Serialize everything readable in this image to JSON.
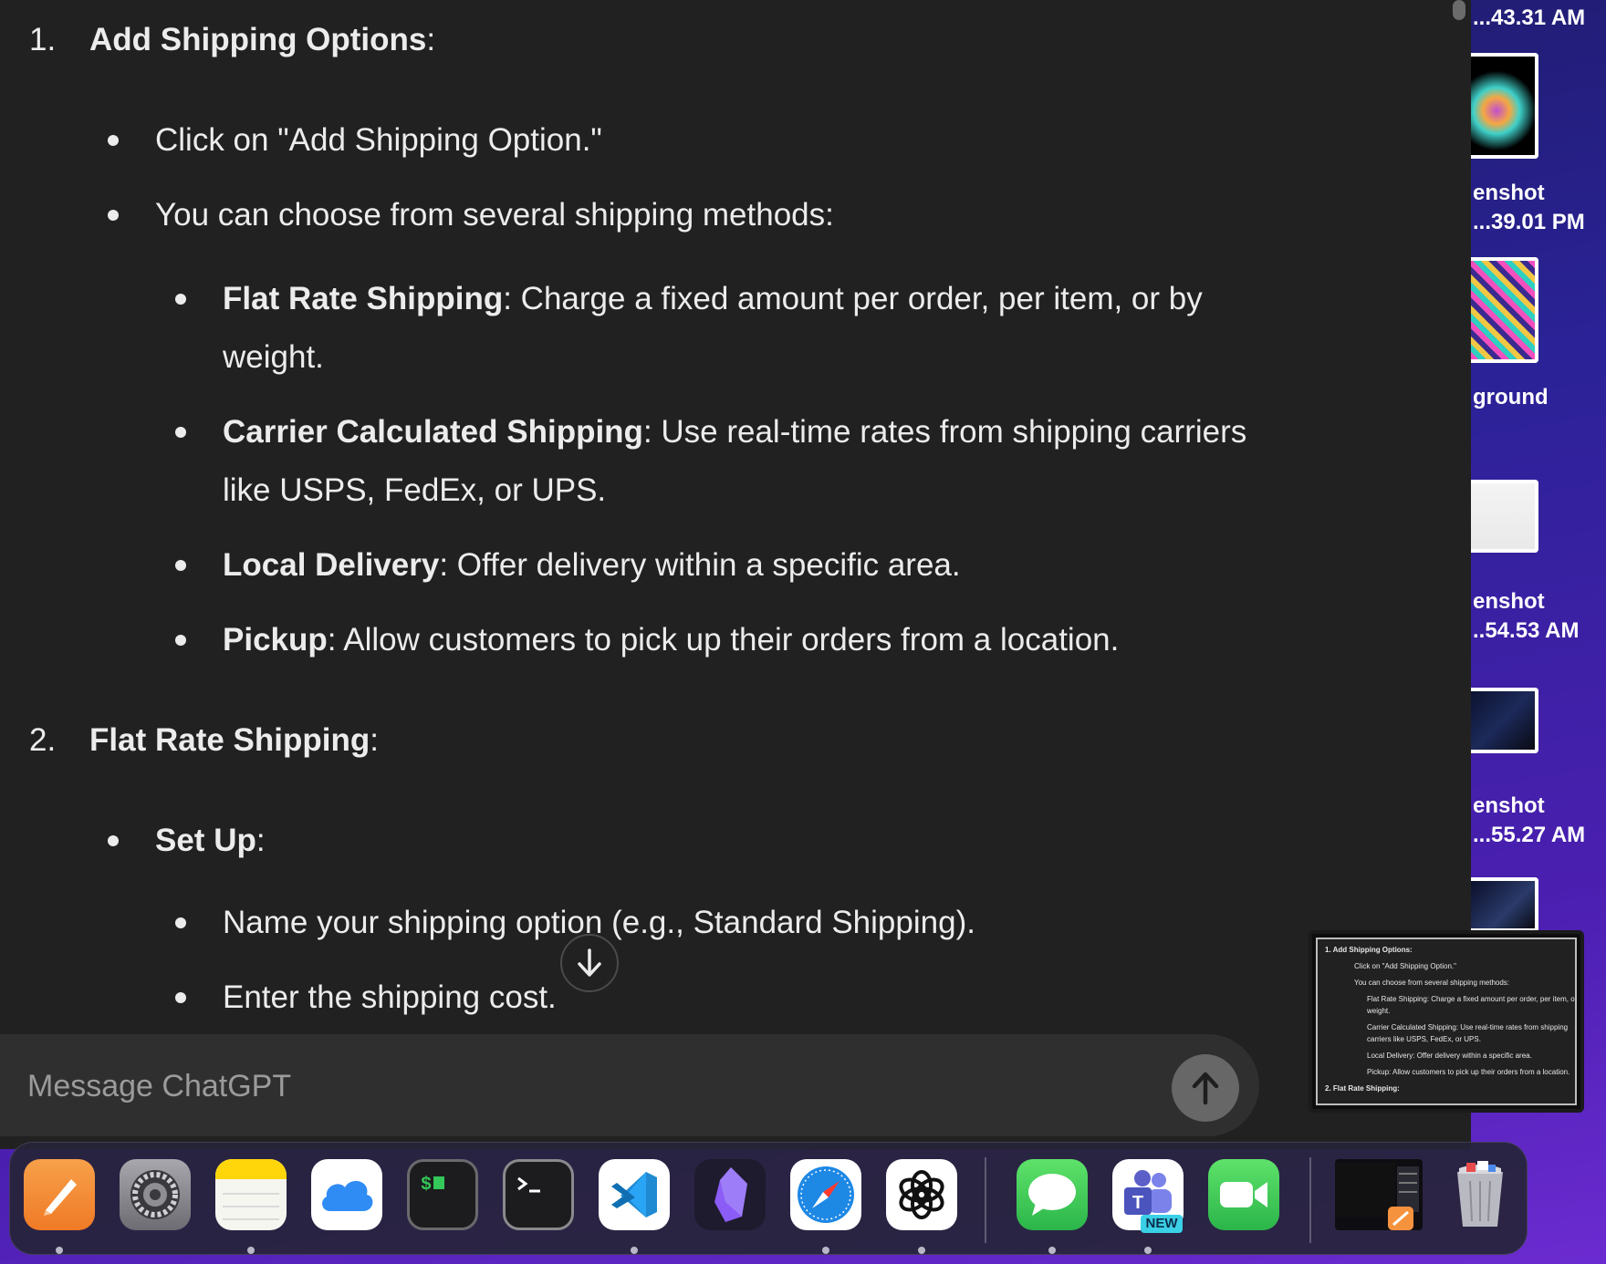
{
  "chat": {
    "sections": [
      {
        "number": "1.",
        "title": "Add Shipping Options",
        "suffix": ":",
        "bullets": [
          {
            "text": "Click on \"Add Shipping Option.\""
          },
          {
            "text": "You can choose from several shipping methods:"
          }
        ],
        "sub_bullets": [
          {
            "bold": "Flat Rate Shipping",
            "rest": ": Charge a fixed amount per order, per item, or by weight."
          },
          {
            "bold": "Carrier Calculated Shipping",
            "rest": ": Use real-time rates from shipping carriers like USPS, FedEx, or UPS."
          },
          {
            "bold": "Local Delivery",
            "rest": ": Offer delivery within a specific area."
          },
          {
            "bold": "Pickup",
            "rest": ": Allow customers to pick up their orders from a location."
          }
        ]
      },
      {
        "number": "2.",
        "title": "Flat Rate Shipping",
        "suffix": ":",
        "bullets": [
          {
            "bold": "Set Up",
            "rest": ":"
          }
        ],
        "sub_bullets": [
          {
            "text": "Name your shipping option (e.g., Standard Shipping)."
          },
          {
            "text": "Enter the shipping cost."
          }
        ]
      }
    ],
    "composer": {
      "placeholder": "Message ChatGPT"
    }
  },
  "desktop": {
    "labels": [
      {
        "line1": "...43.31 AM"
      },
      {
        "line1": "enshot",
        "line2": "...39.01 PM"
      },
      {
        "line1": "ground"
      },
      {
        "line1": "enshot",
        "line2": "..54.53 AM"
      },
      {
        "line1": "enshot",
        "line2": "...55.27 AM"
      }
    ]
  },
  "preview": {
    "lines": [
      "1.   Add Shipping Options:",
      "Click on \"Add Shipping Option.\"",
      "You can choose from several shipping methods:",
      "Flat Rate Shipping: Charge a fixed amount per order, per item, or",
      "weight.",
      "Carrier Calculated Shipping: Use real-time rates from shipping",
      "carriers like USPS, FedEx, or UPS.",
      "Local Delivery: Offer delivery within a specific area.",
      "Pickup: Allow customers to pick up their orders from a location.",
      "2.   Flat Rate Shipping:"
    ]
  },
  "dock": {
    "apps": [
      {
        "name": "Pages",
        "icon": "pencil-icon",
        "color": "#f5923e"
      },
      {
        "name": "System Settings",
        "icon": "gear-icon",
        "color": "#8e8e93"
      },
      {
        "name": "Notes",
        "icon": "notes-icon",
        "color": "#ffd60a"
      },
      {
        "name": "iCloud",
        "icon": "cloud-icon",
        "color": "#2f8cf5"
      },
      {
        "name": "Terminal Dollar",
        "icon": "terminal-dollar-icon",
        "color": "#1c1c1e"
      },
      {
        "name": "Terminal",
        "icon": "terminal-icon",
        "color": "#1c1c1e"
      },
      {
        "name": "Visual Studio Code",
        "icon": "vscode-icon",
        "color": "#23a9f2"
      },
      {
        "name": "Obsidian",
        "icon": "obsidian-icon",
        "color": "#7c3aed"
      },
      {
        "name": "Safari",
        "icon": "compass-icon",
        "color": "#1e88e5"
      },
      {
        "name": "ChatGPT",
        "icon": "chatgpt-icon",
        "color": "#ffffff"
      },
      {
        "name": "Messages",
        "icon": "speech-bubble-icon",
        "color": "#34c759"
      },
      {
        "name": "Microsoft Teams",
        "icon": "teams-icon",
        "color": "#5b5fc7",
        "badge": "NEW"
      },
      {
        "name": "FaceTime",
        "icon": "video-camera-icon",
        "color": "#34c759"
      },
      {
        "name": "Recent Window",
        "icon": "window-thumbnail-icon",
        "color": "#111111"
      },
      {
        "name": "Trash",
        "icon": "trash-icon",
        "color": "#c7c7cc"
      }
    ]
  }
}
